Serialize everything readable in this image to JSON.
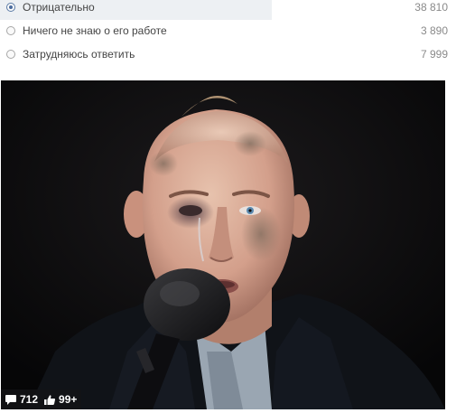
{
  "poll": {
    "options": [
      {
        "label": "Отрицательно",
        "count": "38 810",
        "selected": true,
        "share": 0.59
      },
      {
        "label": "Ничего не знаю о его работе",
        "count": "3 890",
        "selected": false
      },
      {
        "label": "Затрудняюсь ответить",
        "count": "7 999",
        "selected": false
      }
    ],
    "bar_color": "#edf0f3",
    "radio_color": "#4b6c9e"
  },
  "photo": {
    "stats": {
      "comments": "712",
      "likes": "99+"
    }
  }
}
